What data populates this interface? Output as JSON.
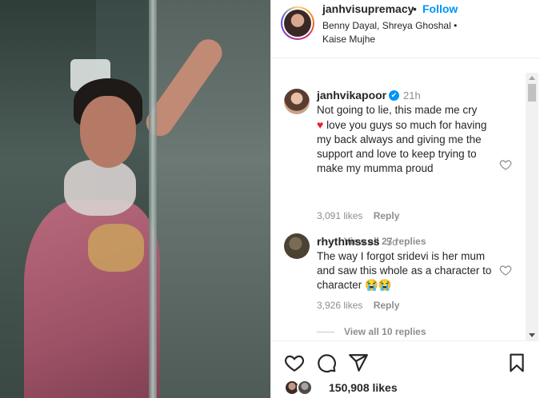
{
  "colors": {
    "accent": "#0095f6",
    "text": "#262626",
    "muted": "#8e8e8e",
    "heart": "#ed1c24"
  },
  "header": {
    "username": "janhvisupremacy",
    "separator": "•",
    "follow_label": "Follow",
    "audio_line": "Benny Dayal, Shreya Ghoshal • Kaise Mujhe"
  },
  "comments": [
    {
      "username": "janhvikapoor",
      "verified": true,
      "time": "21h",
      "text_before_heart": "Not going to lie, this made me cry",
      "heart": "♥",
      "text_after_heart": "love you guys so much for having my back always and giving me the support and love to keep trying to make my mumma proud",
      "likes": "3,091 likes",
      "reply_label": "Reply",
      "view_replies": "View all 27 replies"
    },
    {
      "username": "rhythmssss",
      "verified": false,
      "time": "5d",
      "text": "The way I forgot sridevi is her mum and saw this whole as a character to character 😭😭",
      "likes": "3,926 likes",
      "reply_label": "Reply",
      "view_replies": "View all 10 replies"
    }
  ],
  "actions": {
    "icons": [
      "heart-icon",
      "comment-icon",
      "share-icon",
      "bookmark-icon"
    ],
    "likes_total": "150,908 likes"
  }
}
